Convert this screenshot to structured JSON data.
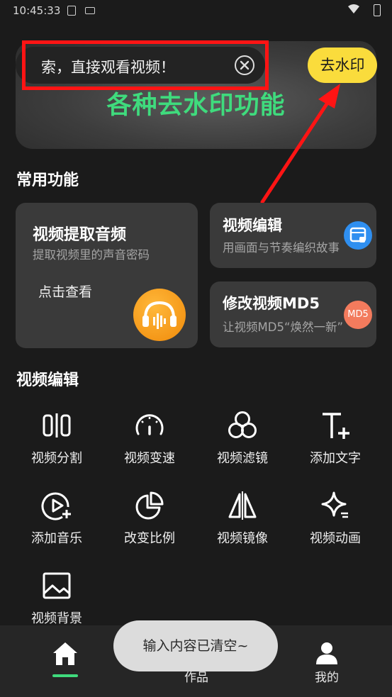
{
  "status_bar": {
    "time": "10:45:33"
  },
  "search": {
    "text": "索，直接观看视频！",
    "clear_icon": "close-circle-icon"
  },
  "watermark_button": {
    "label": "去水印"
  },
  "banner": {
    "title": "各种去水印功能"
  },
  "common": {
    "title": "常用功能",
    "audio_card": {
      "title": "视频提取音频",
      "subtitle": "提取视频里的声音密码",
      "link": "点击查看"
    },
    "edit_card": {
      "title": "视频编辑",
      "subtitle": "用画面与节奏编织故事"
    },
    "md5_card": {
      "title": "修改视频MD5",
      "subtitle": "让视频MD5“焕然一新”",
      "badge": "MD5"
    }
  },
  "video_edit": {
    "title": "视频编辑",
    "tools": [
      {
        "label": "视频分割",
        "icon": "split-icon"
      },
      {
        "label": "视频变速",
        "icon": "speedometer-icon"
      },
      {
        "label": "视频滤镜",
        "icon": "filter-icon"
      },
      {
        "label": "添加文字",
        "icon": "add-text-icon"
      },
      {
        "label": "添加音乐",
        "icon": "add-music-icon"
      },
      {
        "label": "改变比例",
        "icon": "pie-ratio-icon"
      },
      {
        "label": "视频镜像",
        "icon": "mirror-icon"
      },
      {
        "label": "视频动画",
        "icon": "sparkle-icon"
      },
      {
        "label": "视频背景",
        "icon": "image-background-icon"
      }
    ]
  },
  "nav": {
    "items": [
      {
        "label": "",
        "icon": "home-icon"
      },
      {
        "label": "作品",
        "icon": "works-icon"
      },
      {
        "label": "我的",
        "icon": "user-icon"
      }
    ]
  },
  "toast": {
    "message": "输入内容已清空~"
  },
  "colors": {
    "accent_green": "#3fdb7d",
    "watermark_yellow": "#fadc3c",
    "highlight_red": "#ff1414"
  }
}
